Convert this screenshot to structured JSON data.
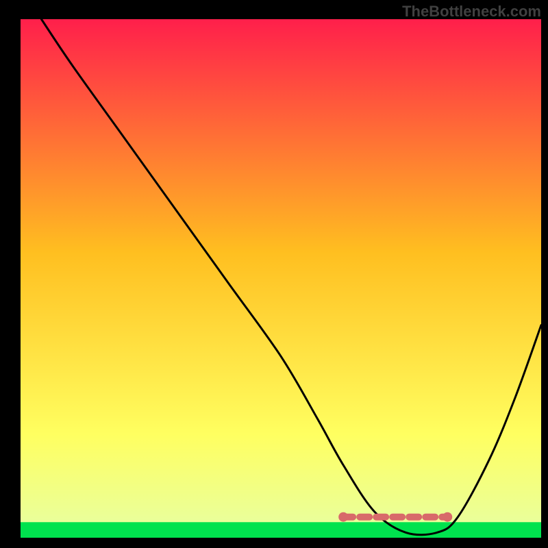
{
  "watermark": "TheBottleneck.com",
  "colors": {
    "curve": "#000000",
    "band_green": "#00e24e",
    "band_red": "#d86a6a",
    "gradient_top": "#ff1f4b",
    "gradient_mid": "#ffbf20",
    "gradient_low": "#ffff60",
    "gradient_bottom": "#00e24e"
  },
  "chart_data": {
    "type": "line",
    "title": "",
    "xlabel": "",
    "ylabel": "",
    "xlim": [
      0,
      100
    ],
    "ylim": [
      0,
      100
    ],
    "x": [
      4,
      10,
      20,
      30,
      40,
      50,
      57,
      62,
      68,
      74,
      80,
      84,
      90,
      95,
      100
    ],
    "y": [
      100,
      91,
      77,
      63,
      49,
      35,
      23,
      14,
      5,
      1,
      1,
      4,
      15,
      27,
      41
    ],
    "optimal_band": {
      "x_start": 62,
      "x_end": 82,
      "y": 4
    },
    "green_strip_y": [
      0,
      3
    ]
  }
}
